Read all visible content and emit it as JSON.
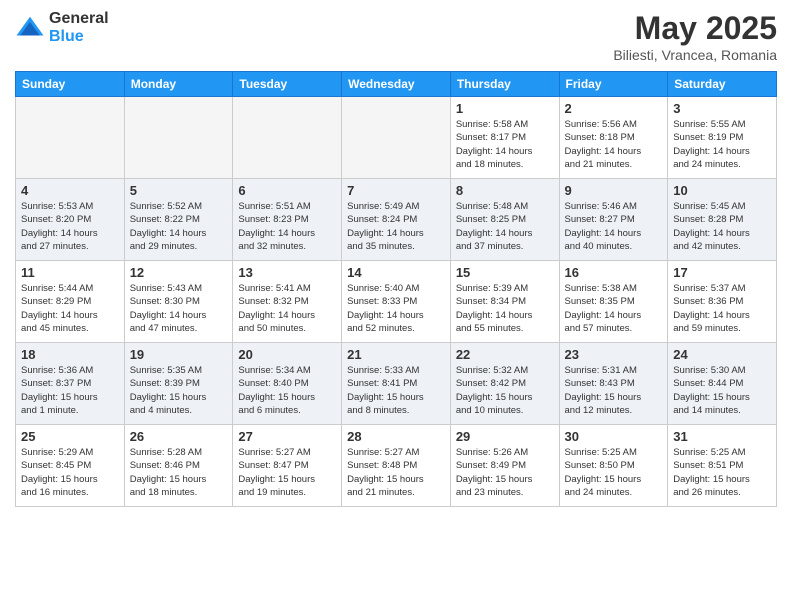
{
  "header": {
    "logo_general": "General",
    "logo_blue": "Blue",
    "month_title": "May 2025",
    "location": "Biliesti, Vrancea, Romania"
  },
  "days_of_week": [
    "Sunday",
    "Monday",
    "Tuesday",
    "Wednesday",
    "Thursday",
    "Friday",
    "Saturday"
  ],
  "weeks": [
    [
      {
        "day": "",
        "info": ""
      },
      {
        "day": "",
        "info": ""
      },
      {
        "day": "",
        "info": ""
      },
      {
        "day": "",
        "info": ""
      },
      {
        "day": "1",
        "info": "Sunrise: 5:58 AM\nSunset: 8:17 PM\nDaylight: 14 hours\nand 18 minutes."
      },
      {
        "day": "2",
        "info": "Sunrise: 5:56 AM\nSunset: 8:18 PM\nDaylight: 14 hours\nand 21 minutes."
      },
      {
        "day": "3",
        "info": "Sunrise: 5:55 AM\nSunset: 8:19 PM\nDaylight: 14 hours\nand 24 minutes."
      }
    ],
    [
      {
        "day": "4",
        "info": "Sunrise: 5:53 AM\nSunset: 8:20 PM\nDaylight: 14 hours\nand 27 minutes."
      },
      {
        "day": "5",
        "info": "Sunrise: 5:52 AM\nSunset: 8:22 PM\nDaylight: 14 hours\nand 29 minutes."
      },
      {
        "day": "6",
        "info": "Sunrise: 5:51 AM\nSunset: 8:23 PM\nDaylight: 14 hours\nand 32 minutes."
      },
      {
        "day": "7",
        "info": "Sunrise: 5:49 AM\nSunset: 8:24 PM\nDaylight: 14 hours\nand 35 minutes."
      },
      {
        "day": "8",
        "info": "Sunrise: 5:48 AM\nSunset: 8:25 PM\nDaylight: 14 hours\nand 37 minutes."
      },
      {
        "day": "9",
        "info": "Sunrise: 5:46 AM\nSunset: 8:27 PM\nDaylight: 14 hours\nand 40 minutes."
      },
      {
        "day": "10",
        "info": "Sunrise: 5:45 AM\nSunset: 8:28 PM\nDaylight: 14 hours\nand 42 minutes."
      }
    ],
    [
      {
        "day": "11",
        "info": "Sunrise: 5:44 AM\nSunset: 8:29 PM\nDaylight: 14 hours\nand 45 minutes."
      },
      {
        "day": "12",
        "info": "Sunrise: 5:43 AM\nSunset: 8:30 PM\nDaylight: 14 hours\nand 47 minutes."
      },
      {
        "day": "13",
        "info": "Sunrise: 5:41 AM\nSunset: 8:32 PM\nDaylight: 14 hours\nand 50 minutes."
      },
      {
        "day": "14",
        "info": "Sunrise: 5:40 AM\nSunset: 8:33 PM\nDaylight: 14 hours\nand 52 minutes."
      },
      {
        "day": "15",
        "info": "Sunrise: 5:39 AM\nSunset: 8:34 PM\nDaylight: 14 hours\nand 55 minutes."
      },
      {
        "day": "16",
        "info": "Sunrise: 5:38 AM\nSunset: 8:35 PM\nDaylight: 14 hours\nand 57 minutes."
      },
      {
        "day": "17",
        "info": "Sunrise: 5:37 AM\nSunset: 8:36 PM\nDaylight: 14 hours\nand 59 minutes."
      }
    ],
    [
      {
        "day": "18",
        "info": "Sunrise: 5:36 AM\nSunset: 8:37 PM\nDaylight: 15 hours\nand 1 minute."
      },
      {
        "day": "19",
        "info": "Sunrise: 5:35 AM\nSunset: 8:39 PM\nDaylight: 15 hours\nand 4 minutes."
      },
      {
        "day": "20",
        "info": "Sunrise: 5:34 AM\nSunset: 8:40 PM\nDaylight: 15 hours\nand 6 minutes."
      },
      {
        "day": "21",
        "info": "Sunrise: 5:33 AM\nSunset: 8:41 PM\nDaylight: 15 hours\nand 8 minutes."
      },
      {
        "day": "22",
        "info": "Sunrise: 5:32 AM\nSunset: 8:42 PM\nDaylight: 15 hours\nand 10 minutes."
      },
      {
        "day": "23",
        "info": "Sunrise: 5:31 AM\nSunset: 8:43 PM\nDaylight: 15 hours\nand 12 minutes."
      },
      {
        "day": "24",
        "info": "Sunrise: 5:30 AM\nSunset: 8:44 PM\nDaylight: 15 hours\nand 14 minutes."
      }
    ],
    [
      {
        "day": "25",
        "info": "Sunrise: 5:29 AM\nSunset: 8:45 PM\nDaylight: 15 hours\nand 16 minutes."
      },
      {
        "day": "26",
        "info": "Sunrise: 5:28 AM\nSunset: 8:46 PM\nDaylight: 15 hours\nand 18 minutes."
      },
      {
        "day": "27",
        "info": "Sunrise: 5:27 AM\nSunset: 8:47 PM\nDaylight: 15 hours\nand 19 minutes."
      },
      {
        "day": "28",
        "info": "Sunrise: 5:27 AM\nSunset: 8:48 PM\nDaylight: 15 hours\nand 21 minutes."
      },
      {
        "day": "29",
        "info": "Sunrise: 5:26 AM\nSunset: 8:49 PM\nDaylight: 15 hours\nand 23 minutes."
      },
      {
        "day": "30",
        "info": "Sunrise: 5:25 AM\nSunset: 8:50 PM\nDaylight: 15 hours\nand 24 minutes."
      },
      {
        "day": "31",
        "info": "Sunrise: 5:25 AM\nSunset: 8:51 PM\nDaylight: 15 hours\nand 26 minutes."
      }
    ]
  ]
}
